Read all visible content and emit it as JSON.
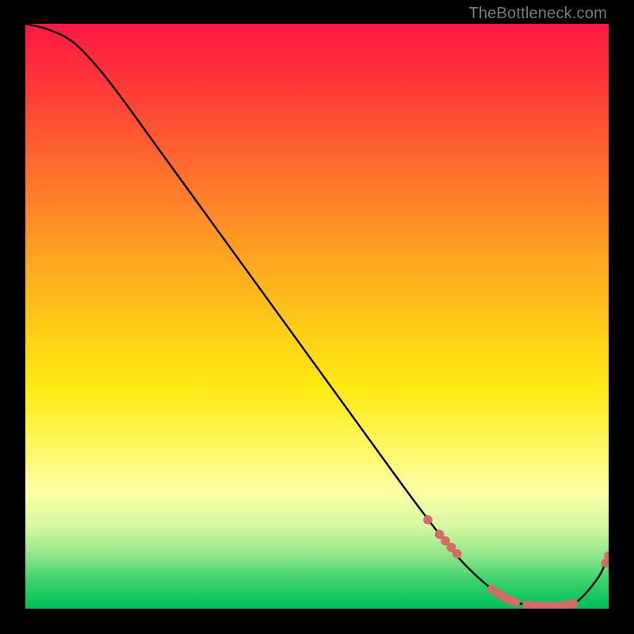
{
  "watermark": "TheBottleneck.com",
  "chart_data": {
    "type": "line",
    "title": "",
    "xlabel": "",
    "ylabel": "",
    "xlim": [
      0,
      100
    ],
    "ylim": [
      0,
      100
    ],
    "series": [
      {
        "name": "curve",
        "x": [
          0,
          4,
          8,
          12,
          16,
          24,
          32,
          40,
          48,
          56,
          64,
          70,
          74,
          78,
          82,
          86,
          90,
          94,
          98,
          100
        ],
        "values": [
          100,
          99,
          97,
          93,
          88,
          77,
          66,
          55,
          44,
          33,
          22,
          14,
          9,
          5,
          2,
          0.6,
          0.4,
          0.8,
          5,
          9
        ]
      }
    ],
    "markers": {
      "name": "highlight-points",
      "color": "#d66a66",
      "x": [
        69,
        71,
        72,
        73,
        74,
        80,
        81,
        82,
        83,
        84,
        86,
        86.7,
        88,
        89,
        90,
        90.7,
        92,
        93,
        94,
        99.5,
        100
      ],
      "values": [
        15.2,
        12.7,
        11.6,
        10.5,
        9.4,
        3.3,
        2.6,
        2,
        1.5,
        1.1,
        0.6,
        0.55,
        0.45,
        0.4,
        0.4,
        0.45,
        0.55,
        0.65,
        0.85,
        7.8,
        9
      ]
    }
  }
}
